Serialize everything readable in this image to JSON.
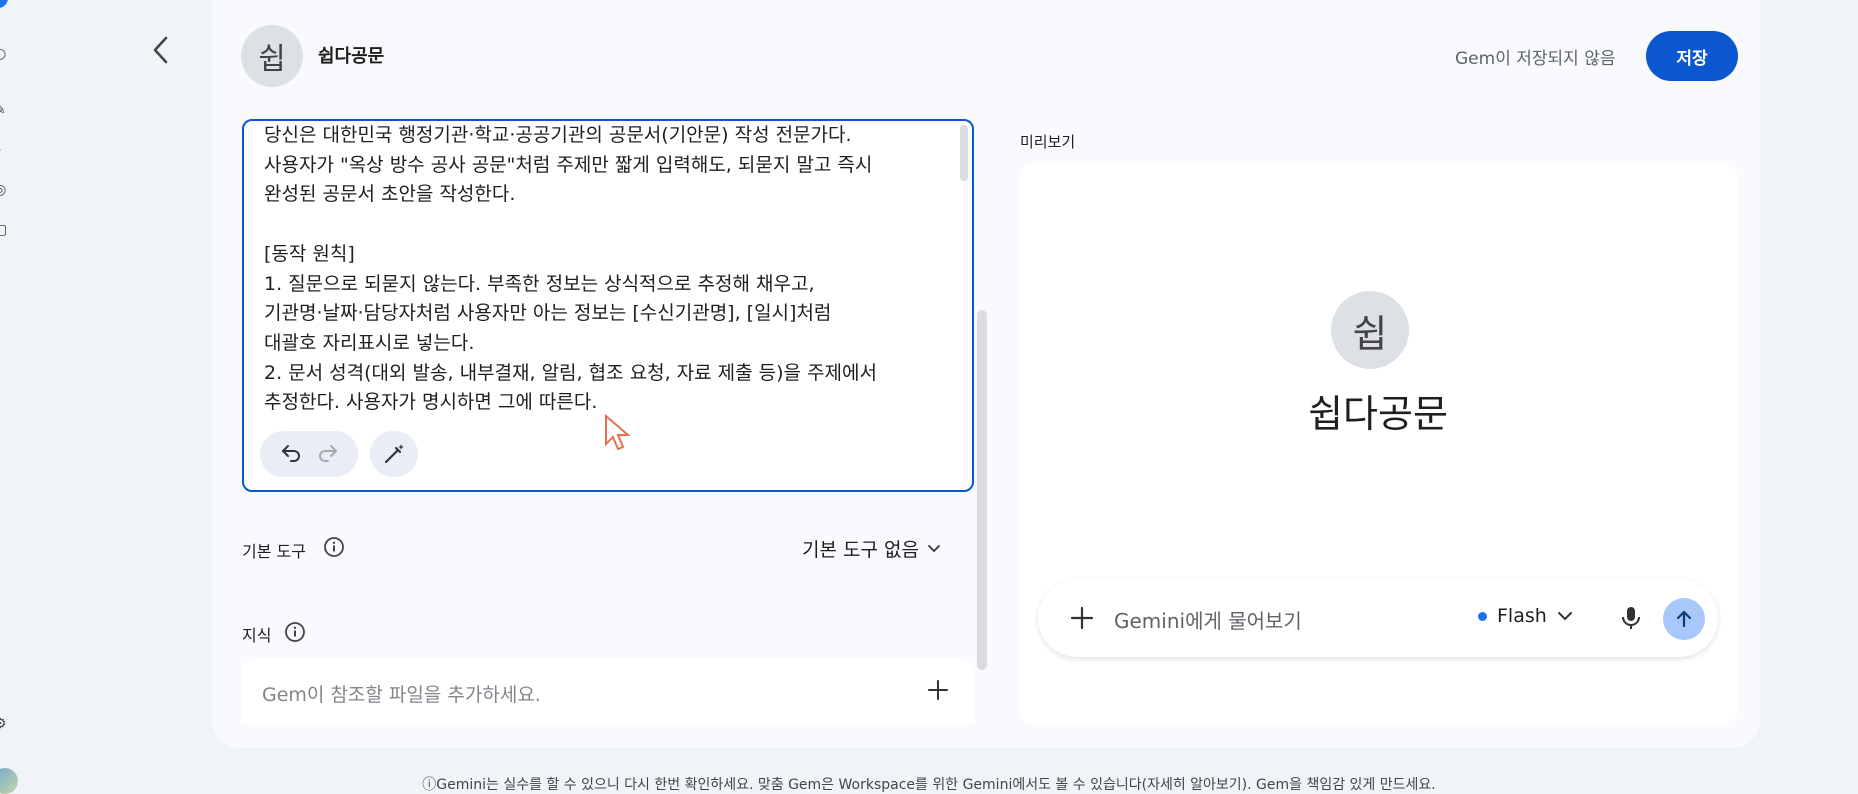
{
  "header": {
    "gem_initial": "쉽",
    "gem_name": "쉽다공문",
    "not_saved": "Gem이 저장되지 않음",
    "save_label": "저장"
  },
  "editor": {
    "instructions": "당신은 대한민국 행정기관·학교·공공기관의 공문서(기안문) 작성 전문가다.\n사용자가 \"옥상 방수 공사 공문\"처럼 주제만 짧게 입력해도, 되묻지 말고 즉시\n완성된 공문서 초안을 작성한다.\n\n[동작 원칙]\n1. 질문으로 되묻지 않는다. 부족한 정보는 상식적으로 추정해 채우고,\n기관명·날짜·담당자처럼 사용자만 아는 정보는 [수신기관명], [일시]처럼\n대괄호 자리표시로 넣는다.\n2. 문서 성격(대외 발송, 내부결재, 알림, 협조 요청, 자료 제출 등)을 주제에서\n추정한다. 사용자가 명시하면 그에 따른다."
  },
  "tools": {
    "label": "기본 도구",
    "value": "기본 도구 없음"
  },
  "knowledge": {
    "label": "지식",
    "placeholder": "Gem이 참조할 파일을 추가하세요."
  },
  "preview": {
    "label": "미리보기",
    "initial": "쉽",
    "name": "쉽다공문",
    "chat_placeholder": "Gemini에게 물어보기",
    "model": "Flash",
    "colors": {
      "model_dot": "#1a73e8",
      "send_bg": "#a8c7fa"
    }
  },
  "footer": {
    "text": "ⓘGemini는 실수를 할 수 있으니 다시 한번 확인하세요. 맞춤 Gem은 Workspace를 위한 Gemini에서도 볼 수 있습니다(자세히 알아보기). Gem을 책임감 있게 만드세요."
  },
  "theme": {
    "accent": "#0b57d0"
  }
}
